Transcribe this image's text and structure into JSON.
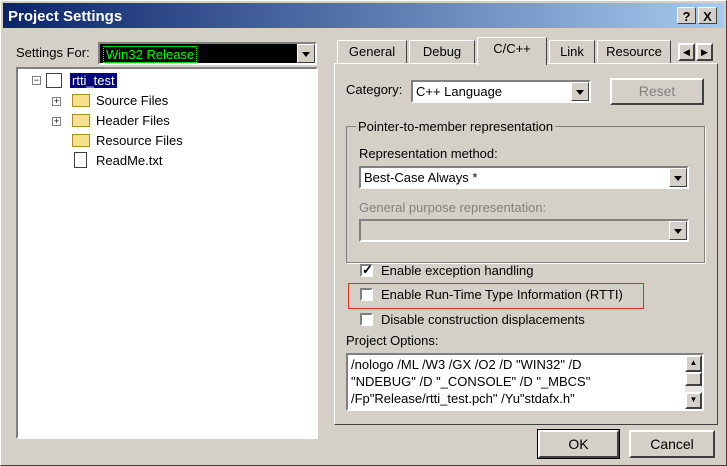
{
  "window": {
    "title": "Project Settings",
    "help_btn": "?",
    "close_btn": "X"
  },
  "settings_for": {
    "label": "Settings For:",
    "value": "Win32 Release"
  },
  "tree": {
    "root": "rtti_test",
    "items": [
      "Source Files",
      "Header Files",
      "Resource Files",
      "ReadMe.txt"
    ]
  },
  "tabs": [
    "General",
    "Debug",
    "C/C++",
    "Link",
    "Resource"
  ],
  "category": {
    "label": "Category:",
    "value": "C++ Language",
    "reset": "Reset"
  },
  "ptm": {
    "group": "Pointer-to-member representation",
    "method_label": "Representation method:",
    "method_value": "Best-Case Always *",
    "general_label": "General purpose representation:"
  },
  "checks": [
    {
      "label": "Enable exception handling",
      "checked": true
    },
    {
      "label": "Enable Run-Time Type Information (RTTI)",
      "checked": false
    },
    {
      "label": "Disable construction displacements",
      "checked": false
    }
  ],
  "project_options": {
    "label": "Project Options:",
    "lines": [
      "/nologo /ML /W3 /GX /O2 /D \"WIN32\" /D",
      "\"NDEBUG\" /D \"_CONSOLE\" /D \"_MBCS\"",
      "/Fp\"Release/rtti_test.pch\" /Yu\"stdafx.h\""
    ]
  },
  "buttons": {
    "ok": "OK",
    "cancel": "Cancel"
  },
  "colors": {
    "title_start": "#0a246a",
    "title_end": "#a6caf0",
    "selection": "#000080",
    "highlight_box": "#e03020",
    "combo_text": "#00ff00"
  }
}
